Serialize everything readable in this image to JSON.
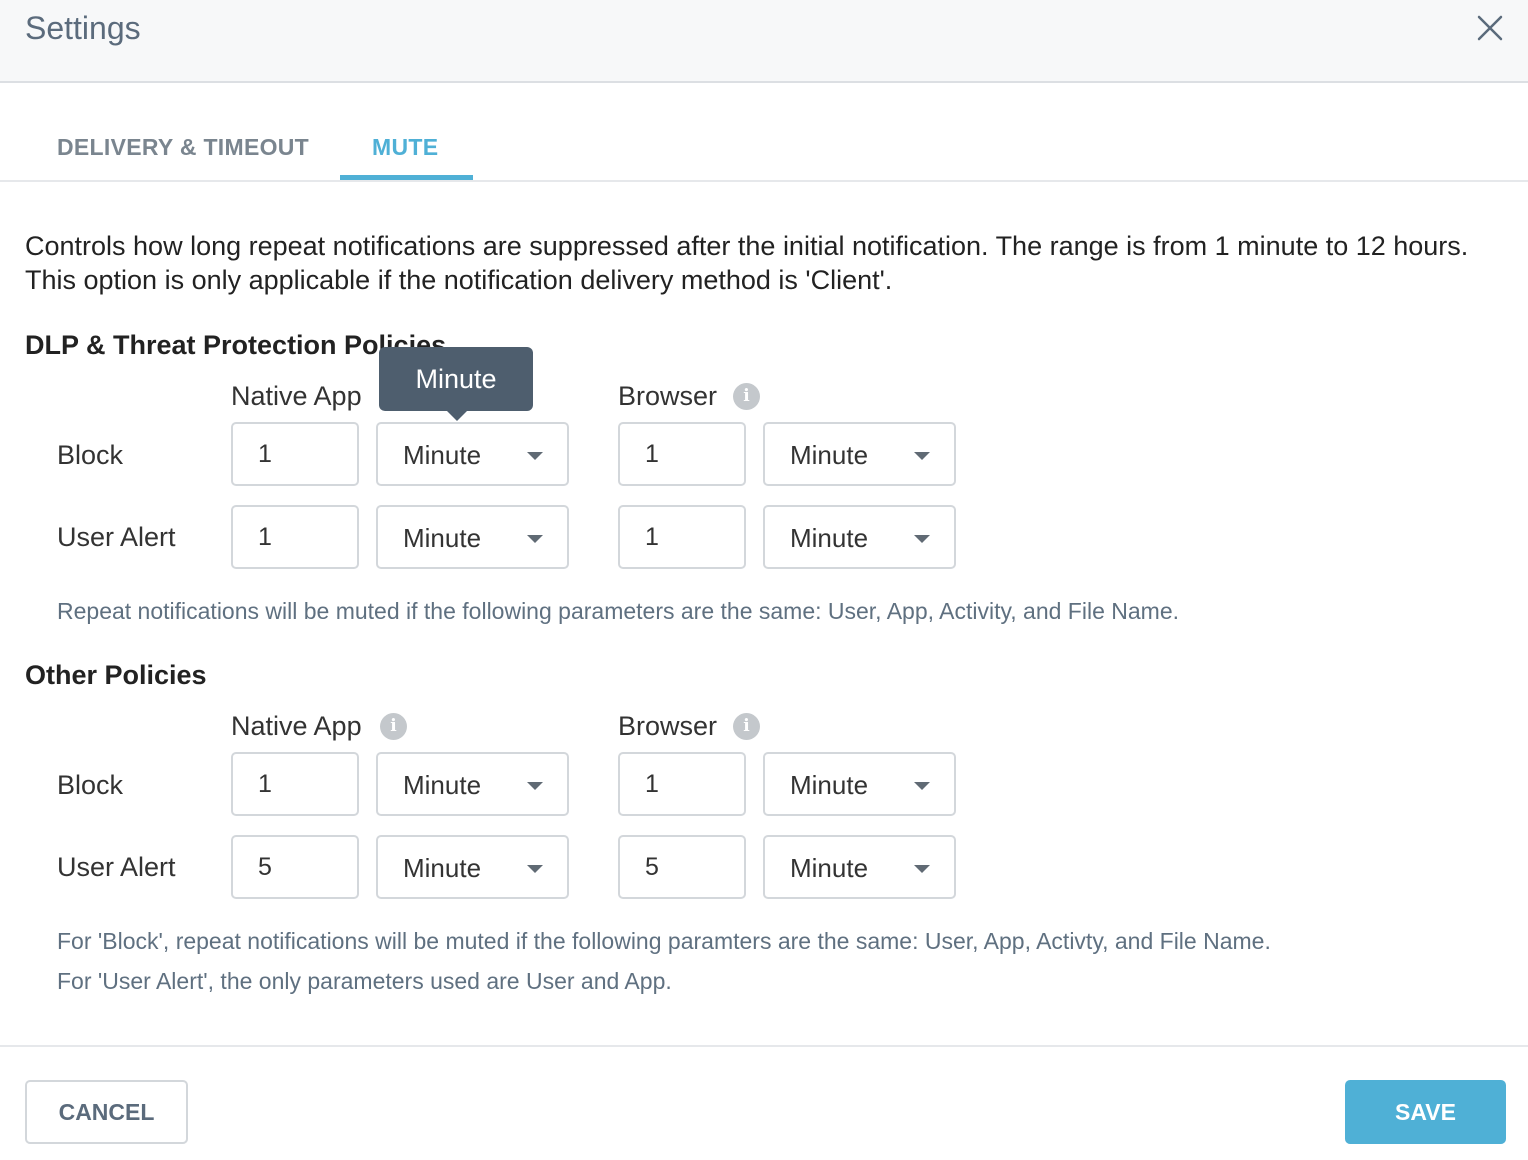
{
  "dialog": {
    "title": "Settings"
  },
  "tabs": [
    {
      "label": "DELIVERY & TIMEOUT",
      "active": false
    },
    {
      "label": "MUTE",
      "active": true
    }
  ],
  "description": "Controls how long repeat notifications are suppressed after the initial notification. The range is from 1 minute to 12 hours. This option is only applicable if the notification delivery method is 'Client'.",
  "dlp_section": {
    "title": "DLP & Threat Protection Policies",
    "native_app_label": "Native App",
    "browser_label": "Browser",
    "rows": [
      {
        "label": "Block",
        "native_value": "1",
        "native_unit": "Minute",
        "browser_value": "1",
        "browser_unit": "Minute"
      },
      {
        "label": "User Alert",
        "native_value": "1",
        "native_unit": "Minute",
        "browser_value": "1",
        "browser_unit": "Minute"
      }
    ],
    "note": "Repeat notifications will be muted if the following parameters are the same: User, App, Activity, and File Name."
  },
  "tooltip": {
    "text": "Minute"
  },
  "other_section": {
    "title": "Other Policies",
    "native_app_label": "Native App",
    "browser_label": "Browser",
    "rows": [
      {
        "label": "Block",
        "native_value": "1",
        "native_unit": "Minute",
        "browser_value": "1",
        "browser_unit": "Minute"
      },
      {
        "label": "User Alert",
        "native_value": "5",
        "native_unit": "Minute",
        "browser_value": "5",
        "browser_unit": "Minute"
      }
    ],
    "notes": [
      "For 'Block', repeat notifications will be muted if the following paramters are the same: User, App, Activty, and File Name.",
      "For 'User Alert', the only parameters used are User and App."
    ]
  },
  "footer": {
    "cancel_label": "CANCEL",
    "save_label": "SAVE"
  },
  "icons": {
    "close": "close-icon",
    "info": "info-icon",
    "dropdown": "chevron-down-icon"
  },
  "colors": {
    "accent": "#4fb0d6",
    "tooltip_bg": "#4e5e6e",
    "note_text": "#5f7080"
  }
}
